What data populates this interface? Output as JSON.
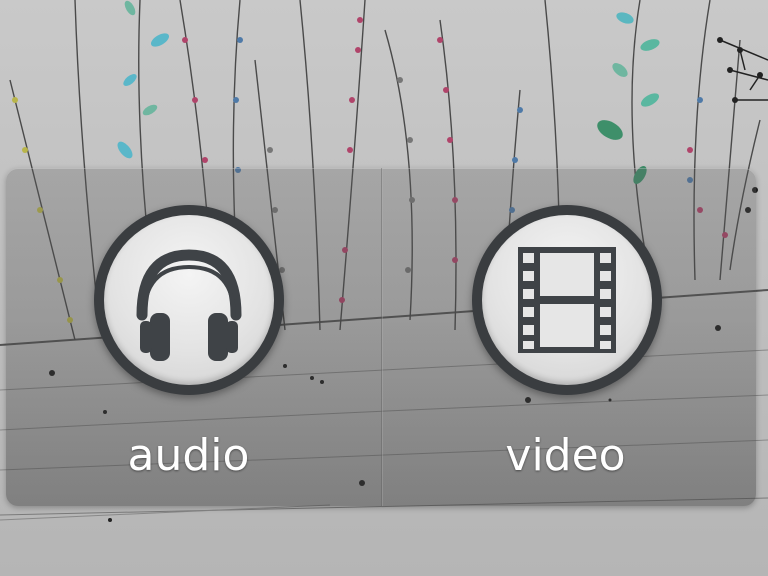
{
  "tiles": [
    {
      "id": "audio",
      "label": "audio",
      "icon": "headphones-icon"
    },
    {
      "id": "video",
      "label": "video",
      "icon": "film-strip-icon"
    }
  ],
  "colors": {
    "wallpaper_base": "#bdbdbd",
    "button_ring": "#3a3d40",
    "button_face": "#e6e6e6",
    "icon": "#3f4347",
    "label": "#ffffff"
  }
}
